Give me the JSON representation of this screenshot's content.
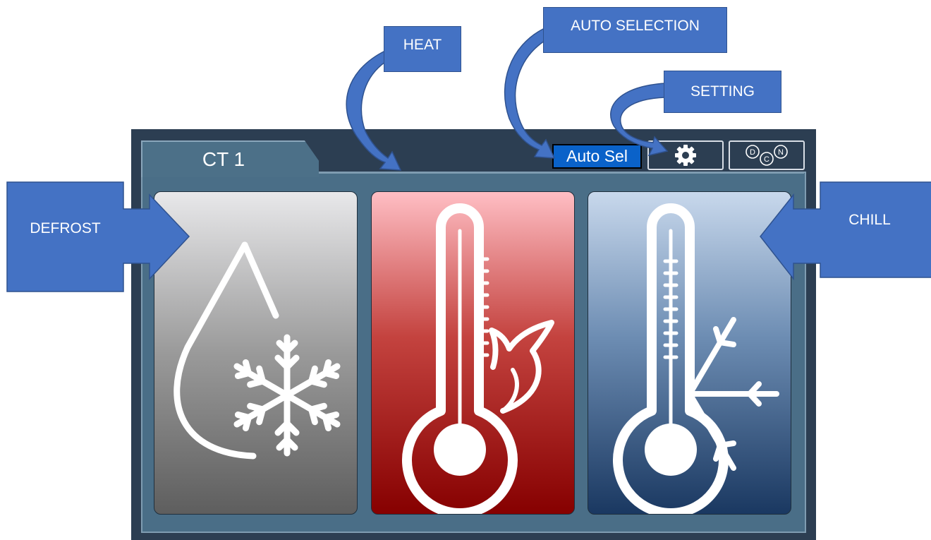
{
  "panel": {
    "tab_label": "CT 1",
    "auto_button_label": "Auto Sel",
    "setting_icon": "gear-icon",
    "dcn_icon": "dcn-logo-icon",
    "dcn_letters": [
      "D",
      "C",
      "N"
    ]
  },
  "modes": [
    {
      "key": "defrost",
      "icon": "drop-snowflake-icon"
    },
    {
      "key": "heat",
      "icon": "thermometer-flame-icon"
    },
    {
      "key": "chill",
      "icon": "thermometer-snowflake-icon"
    }
  ],
  "callouts": {
    "heat": "HEAT",
    "auto": "AUTO SELECTION",
    "setting": "SETTING",
    "defrost": "DEFROST",
    "chill": "CHILL"
  },
  "colors": {
    "auto_button": "#0a62c9",
    "callout": "#4472c4",
    "heat_tile": "#c4433f",
    "chill_tile": "#1a3861",
    "defrost_tile": "#9a9a9a"
  }
}
